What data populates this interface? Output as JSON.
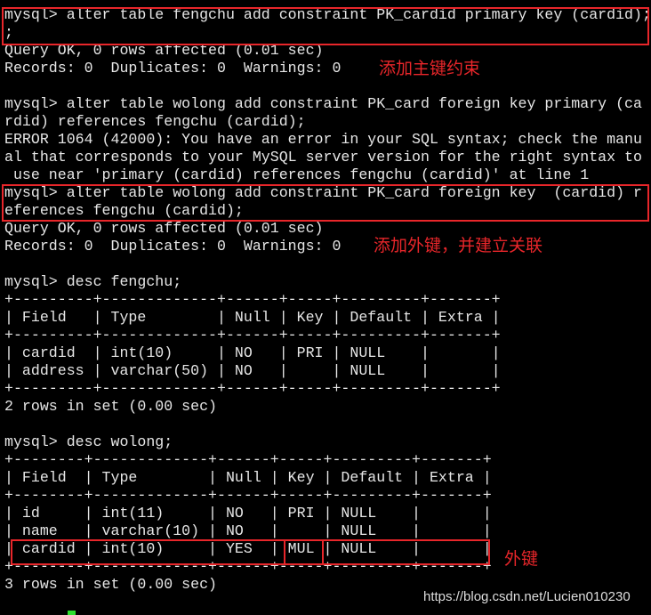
{
  "terminal": {
    "lines": [
      "mysql> alter table fengchu add constraint PK_cardid primary key (cardid);",
      ";",
      "Query OK, 0 rows affected (0.01 sec)",
      "Records: 0  Duplicates: 0  Warnings: 0",
      "",
      "mysql> alter table wolong add constraint PK_card foreign key primary (ca",
      "rdid) references fengchu (cardid);",
      "ERROR 1064 (42000): You have an error in your SQL syntax; check the manu",
      "al that corresponds to your MySQL server version for the right syntax to",
      " use near 'primary (cardid) references fengchu (cardid)' at line 1",
      "mysql> alter table wolong add constraint PK_card foreign key  (cardid) r",
      "eferences fengchu (cardid);",
      "Query OK, 0 rows affected (0.01 sec)",
      "Records: 0  Duplicates: 0  Warnings: 0",
      "",
      "mysql> desc fengchu;",
      "+---------+-------------+------+-----+---------+-------+",
      "| Field   | Type        | Null | Key | Default | Extra |",
      "+---------+-------------+------+-----+---------+-------+",
      "| cardid  | int(10)     | NO   | PRI | NULL    |       |",
      "| address | varchar(50) | NO   |     | NULL    |       |",
      "+---------+-------------+------+-----+---------+-------+",
      "2 rows in set (0.00 sec)",
      "",
      "mysql> desc wolong;",
      "+--------+-------------+------+-----+---------+-------+",
      "| Field  | Type        | Null | Key | Default | Extra |",
      "+--------+-------------+------+-----+---------+-------+",
      "| id     | int(11)     | NO   | PRI | NULL    |       |",
      "| name   | varchar(10) | NO   |     | NULL    |       |",
      "| cardid | int(10)     | YES  | MUL | NULL    |       |",
      "+--------+-------------+------+-----+---------+-------+",
      "3 rows in set (0.00 sec)"
    ]
  },
  "annotations": {
    "primary_key": "添加主键约束",
    "foreign_key": "添加外键，并建立关联",
    "foreign_key_short": "外键"
  },
  "watermark": "https://blog.csdn.net/Lucien010230",
  "colors": {
    "annotation": "#e8262a",
    "text": "#e6e6e6",
    "background": "#000000",
    "cursor": "#2ee02e"
  }
}
